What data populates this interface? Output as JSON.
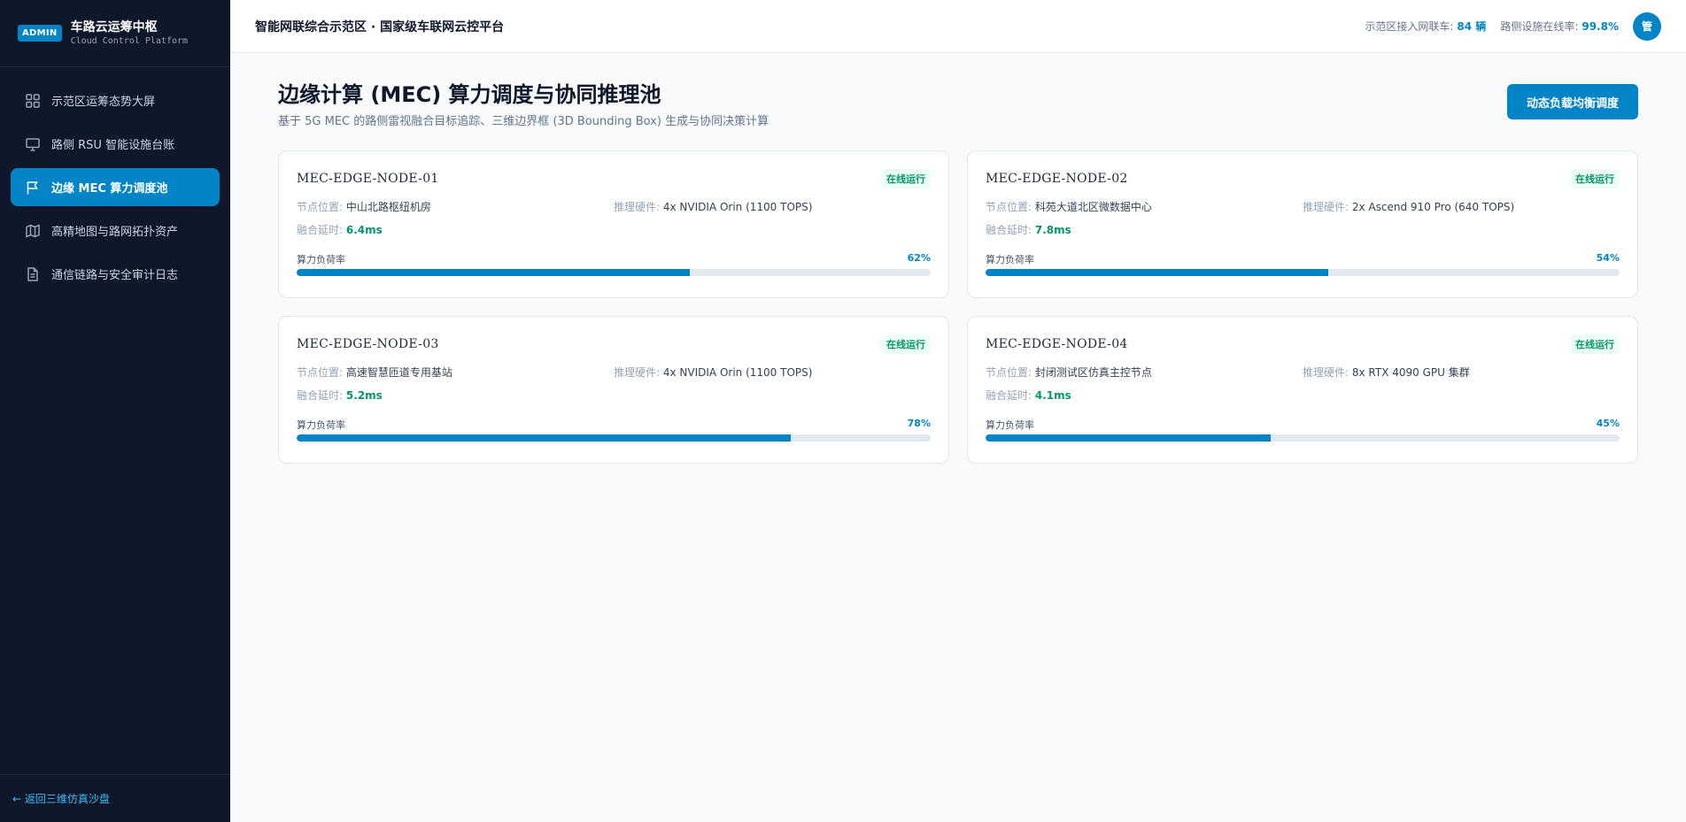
{
  "sidebar": {
    "badge": "ADMIN",
    "title": "车路云运筹中枢",
    "subtitle": "Cloud Control Platform",
    "items": [
      {
        "label": "示范区运筹态势大屏",
        "icon": "grid-icon"
      },
      {
        "label": "路侧 RSU 智能设施台账",
        "icon": "monitor-icon"
      },
      {
        "label": "边缘 MEC 算力调度池",
        "icon": "flag-icon",
        "active": true
      },
      {
        "label": "高精地图与路网拓扑资产",
        "icon": "map-icon"
      },
      {
        "label": "通信链路与安全审计日志",
        "icon": "document-icon"
      }
    ],
    "back_link": "← 返回三维仿真沙盘"
  },
  "header": {
    "title": "智能网联综合示范区 · 国家级车联网云控平台",
    "stat1_label": "示范区接入网联车:",
    "stat1_value": "84 辆",
    "stat2_label": "路侧设施在线率:",
    "stat2_value": "99.8%",
    "avatar": "管"
  },
  "main": {
    "title": "边缘计算 (MEC) 算力调度与协同推理池",
    "description": "基于 5G MEC 的路侧雷视融合目标追踪、三维边界框 (3D Bounding Box) 生成与协同决策计算",
    "button": "动态负载均衡调度",
    "labels": {
      "location": "节点位置:",
      "hardware": "推理硬件:",
      "latency": "融合延时:",
      "load": "算力负荷率"
    },
    "nodes": [
      {
        "id": "MEC-EDGE-NODE-01",
        "status": "在线运行",
        "location": "中山北路枢纽机房",
        "hardware": "4x NVIDIA Orin (1100 TOPS)",
        "latency": "6.4ms",
        "load_text": "62%",
        "load": 62
      },
      {
        "id": "MEC-EDGE-NODE-02",
        "status": "在线运行",
        "location": "科苑大道北区微数据中心",
        "hardware": "2x Ascend 910 Pro (640 TOPS)",
        "latency": "7.8ms",
        "load_text": "54%",
        "load": 54
      },
      {
        "id": "MEC-EDGE-NODE-03",
        "status": "在线运行",
        "location": "高速智慧匝道专用基站",
        "hardware": "4x NVIDIA Orin (1100 TOPS)",
        "latency": "5.2ms",
        "load_text": "78%",
        "load": 78
      },
      {
        "id": "MEC-EDGE-NODE-04",
        "status": "在线运行",
        "location": "封闭测试区仿真主控节点",
        "hardware": "8x RTX 4090 GPU 集群",
        "latency": "4.1ms",
        "load_text": "45%",
        "load": 45
      }
    ]
  },
  "colors": {
    "sidebar_bg": "#0f172a",
    "accent": "#0284c7",
    "success": "#059669"
  }
}
